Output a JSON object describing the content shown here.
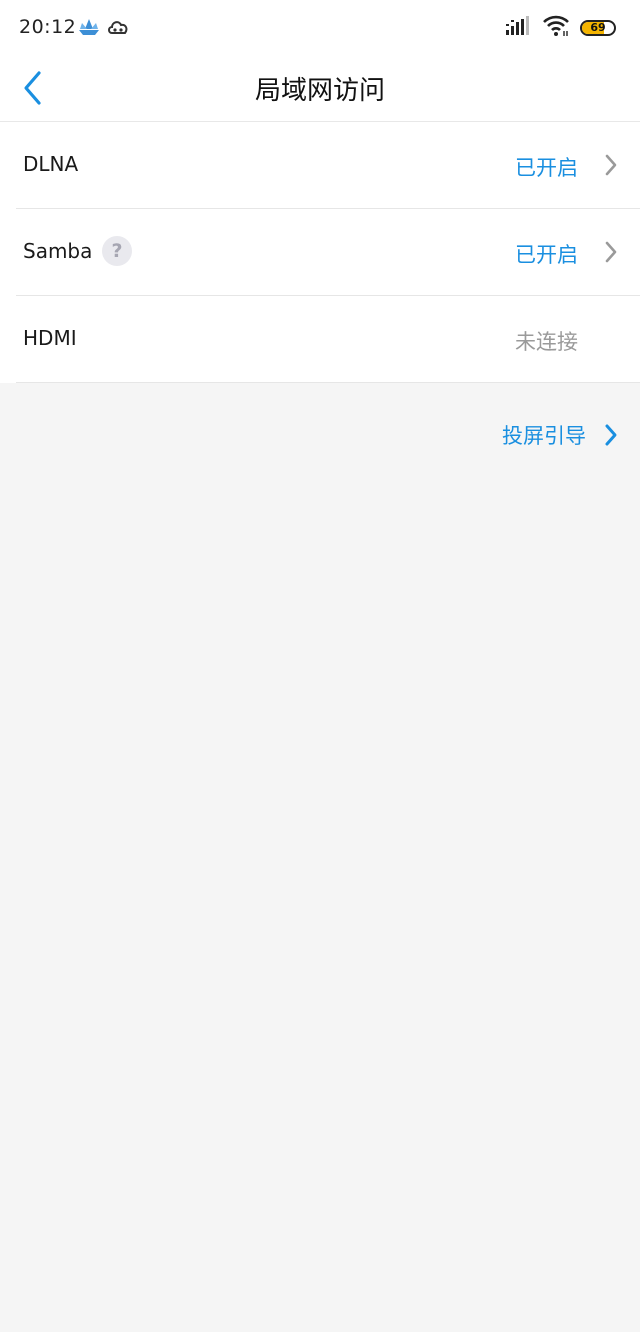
{
  "status_bar": {
    "time": "20:12",
    "battery_level": "69",
    "icons": [
      "boat-notification-icon",
      "cloud-notification-icon",
      "signal-icon",
      "wifi-icon",
      "battery-icon"
    ]
  },
  "header": {
    "title": "局域网访问"
  },
  "rows": [
    {
      "label": "DLNA",
      "value": "已开启",
      "status": "on"
    },
    {
      "label": "Samba",
      "help": "?",
      "value": "已开启",
      "status": "on"
    },
    {
      "label": "HDMI",
      "value": "未连接",
      "status": "off"
    }
  ],
  "guide_link": {
    "label": "投屏引导"
  },
  "colors": {
    "accent": "#1a8fe0",
    "muted": "#9a9a9a",
    "background": "#f5f5f5",
    "battery": "#f4b400"
  }
}
